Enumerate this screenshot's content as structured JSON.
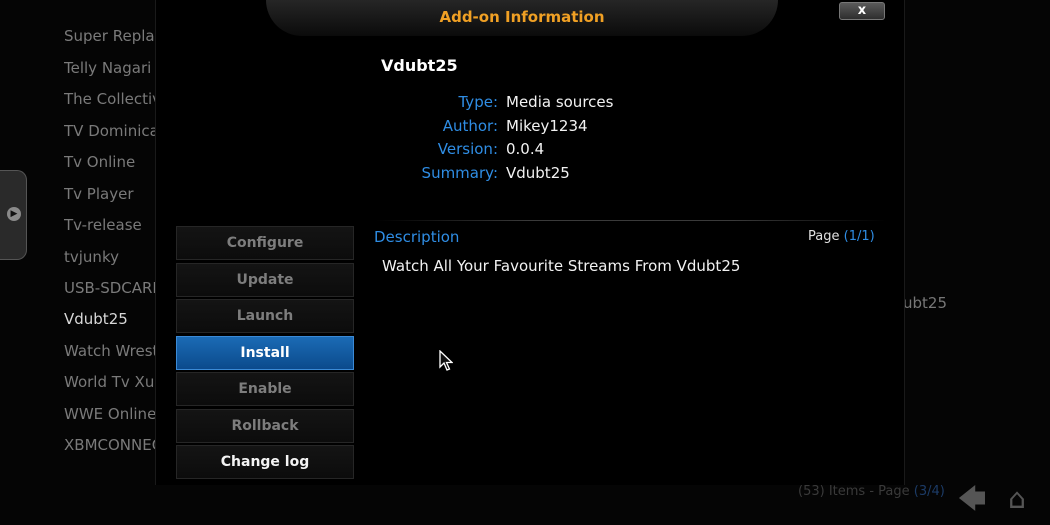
{
  "background": {
    "list_items": [
      "Super Replay",
      "Telly Nagari",
      "The Collective",
      "TV Dominican",
      "Tv Online",
      "Tv Player",
      "Tv-release",
      "tvjunky",
      "USB-SDCARD",
      "Vdubt25",
      "Watch Wrestling",
      "World Tv Xu",
      "WWE Online",
      "XBMCONNECT"
    ],
    "right_text": "ubt25",
    "footer_items": "(53) Items - Page",
    "footer_page": "(3/4)"
  },
  "dialog": {
    "title": "Add-on Information",
    "close_label": "x",
    "addon_name": "Vdubt25",
    "info": [
      {
        "label": "Type:",
        "value": "Media sources"
      },
      {
        "label": "Author:",
        "value": "Mikey1234"
      },
      {
        "label": "Version:",
        "value": "0.0.4"
      },
      {
        "label": "Summary:",
        "value": "Vdubt25"
      }
    ],
    "buttons": [
      "Configure",
      "Update",
      "Launch",
      "Install",
      "Enable",
      "Rollback",
      "Change log"
    ],
    "description_label": "Description",
    "page_prefix": "Page",
    "page_number": "(1/1)",
    "description_text": "Watch All Your Favourite Streams From Vdubt25"
  },
  "colors": {
    "accent_blue": "#2f8de4",
    "title_orange": "#f0a024",
    "selected_button": "#1b6bb5"
  },
  "icons": {
    "back": "back-arrow-icon",
    "home": "home-icon",
    "side": "side-menu-icon"
  }
}
